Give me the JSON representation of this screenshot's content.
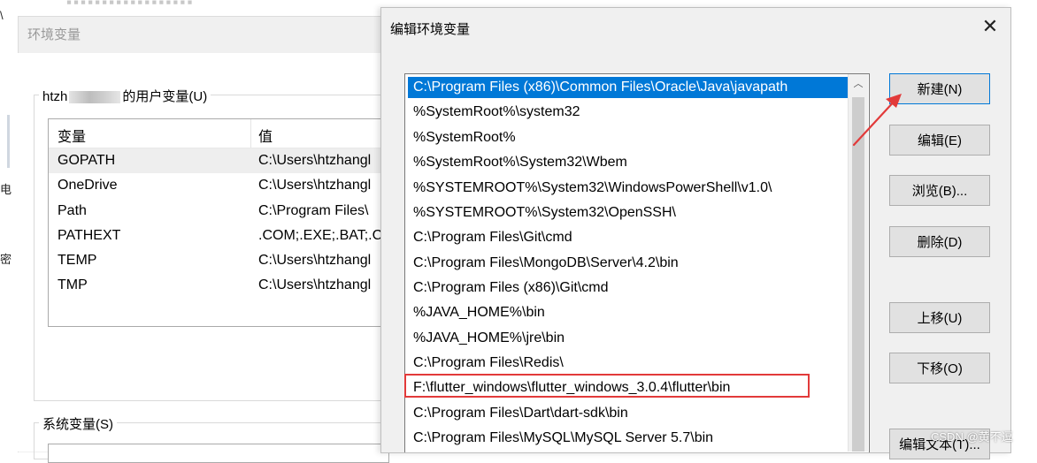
{
  "background_window": {
    "title": "环境变量",
    "user_group_label_prefix": "htzh",
    "user_group_label_suffix": "的用户变量(U)",
    "columns": {
      "name": "变量",
      "value": "值"
    },
    "variables": [
      {
        "name": "GOPATH",
        "value": "C:\\Users\\htzhangl"
      },
      {
        "name": "OneDrive",
        "value": "C:\\Users\\htzhangl"
      },
      {
        "name": "Path",
        "value": "C:\\Program Files\\"
      },
      {
        "name": "PATHEXT",
        "value": ".COM;.EXE;.BAT;.C"
      },
      {
        "name": "TEMP",
        "value": "C:\\Users\\htzhangl"
      },
      {
        "name": "TMP",
        "value": "C:\\Users\\htzhangl"
      }
    ],
    "system_group_label": "系统变量(S)"
  },
  "left_strip": {
    "glyphs": [
      "\\",
      "电",
      "密"
    ]
  },
  "dialog": {
    "title": "编辑环境变量",
    "close_label": "✕",
    "paths": [
      "C:\\Program Files (x86)\\Common Files\\Oracle\\Java\\javapath",
      "%SystemRoot%\\system32",
      "%SystemRoot%",
      "%SystemRoot%\\System32\\Wbem",
      "%SYSTEMROOT%\\System32\\WindowsPowerShell\\v1.0\\",
      "%SYSTEMROOT%\\System32\\OpenSSH\\",
      "C:\\Program Files\\Git\\cmd",
      "C:\\Program Files\\MongoDB\\Server\\4.2\\bin",
      "C:\\Program Files (x86)\\Git\\cmd",
      "%JAVA_HOME%\\bin",
      "%JAVA_HOME%\\jre\\bin",
      "C:\\Program Files\\Redis\\",
      "F:\\flutter_windows\\flutter_windows_3.0.4\\flutter\\bin",
      "C:\\Program Files\\Dart\\dart-sdk\\bin",
      "C:\\Program Files\\MySQL\\MySQL Server 5.7\\bin"
    ],
    "buttons": {
      "new": "新建(N)",
      "edit": "编辑(E)",
      "browse": "浏览(B)...",
      "delete": "删除(D)",
      "move_up": "上移(U)",
      "move_down": "下移(O)",
      "edit_text": "编辑文本(T)..."
    },
    "scroll_up_glyph": "︿"
  },
  "annotation": {
    "color": "#e23a3a"
  },
  "watermark": "CSDN @黄不逗",
  "colors": {
    "selection": "#0078d7",
    "dialog_bg": "#f0f0f0"
  }
}
